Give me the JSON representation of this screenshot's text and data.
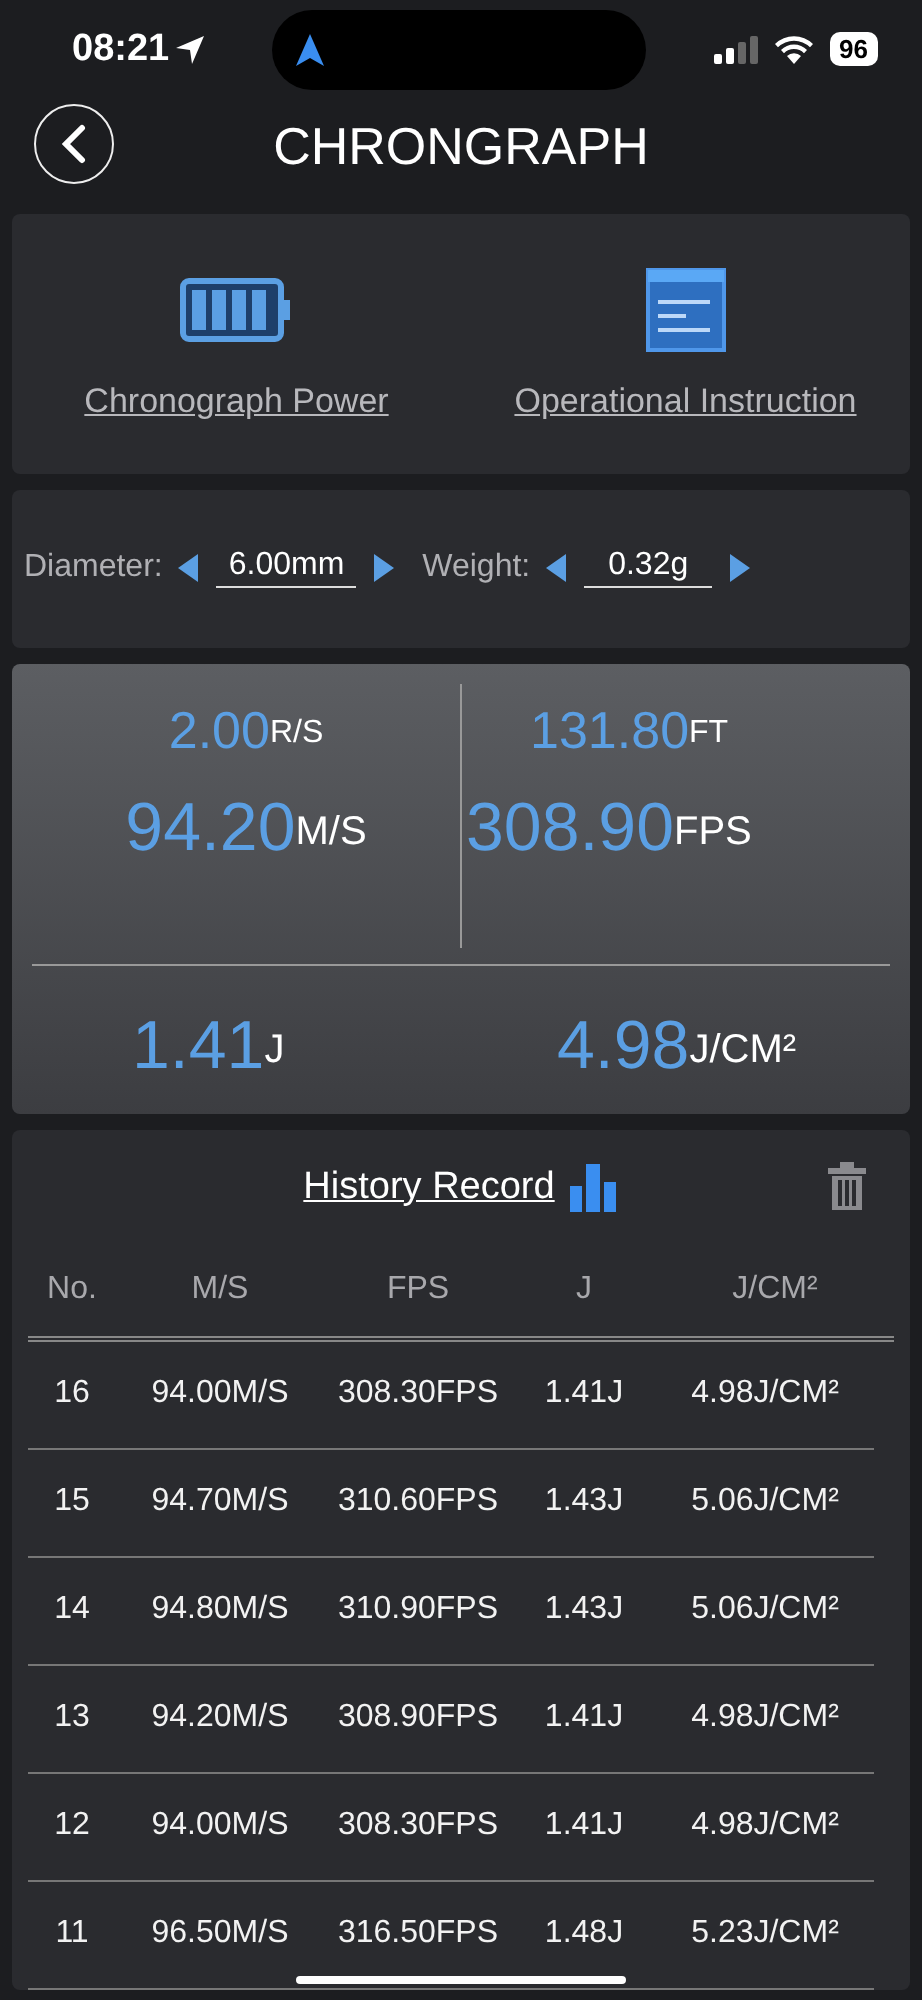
{
  "status_bar": {
    "time": "08:21",
    "battery": "96"
  },
  "header": {
    "title": "CHRONGRAPH"
  },
  "actions": [
    {
      "kind": "battery",
      "label": "Chronograph Power"
    },
    {
      "kind": "document",
      "label": "Operational Instruction"
    }
  ],
  "settings": [
    {
      "label": "Diameter:",
      "value": "6.00mm"
    },
    {
      "label": "Weight:",
      "value": "0.32g"
    }
  ],
  "readings": {
    "top": [
      {
        "small": {
          "value": "2.00",
          "unit": "R/S"
        },
        "big": {
          "value": "94.20",
          "unit": "M/S"
        }
      },
      {
        "small": {
          "value": "131.80",
          "unit": "FT"
        },
        "big": {
          "value": "308.90",
          "unit": "FPS"
        }
      }
    ],
    "bottom": [
      {
        "value": "1.41",
        "unit": "J"
      },
      {
        "value": "4.98",
        "unit": "J/CM²"
      }
    ]
  },
  "history": {
    "title": "History Record",
    "columns": [
      "No.",
      "M/S",
      "FPS",
      "J",
      "J/CM²"
    ],
    "rows": [
      [
        "16",
        "94.00M/S",
        "308.30FPS",
        "1.41J",
        "4.98J/CM²"
      ],
      [
        "15",
        "94.70M/S",
        "310.60FPS",
        "1.43J",
        "5.06J/CM²"
      ],
      [
        "14",
        "94.80M/S",
        "310.90FPS",
        "1.43J",
        "5.06J/CM²"
      ],
      [
        "13",
        "94.20M/S",
        "308.90FPS",
        "1.41J",
        "4.98J/CM²"
      ],
      [
        "12",
        "94.00M/S",
        "308.30FPS",
        "1.41J",
        "4.98J/CM²"
      ],
      [
        "11",
        "96.50M/S",
        "316.50FPS",
        "1.48J",
        "5.23J/CM²"
      ]
    ]
  }
}
